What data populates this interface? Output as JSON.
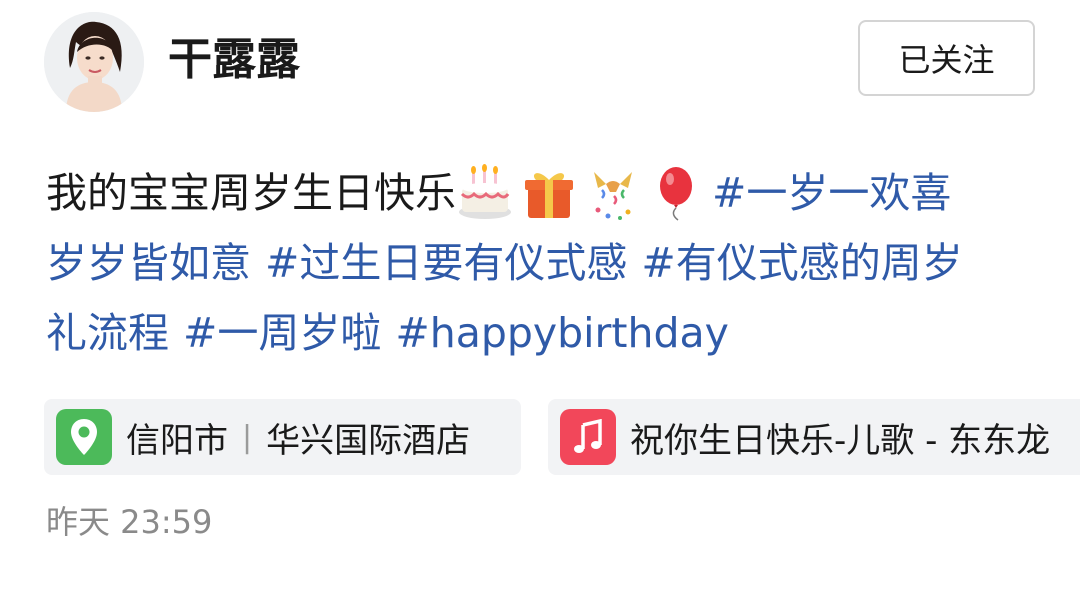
{
  "author": {
    "name": "干露露",
    "follow_label": "已关注"
  },
  "post": {
    "line1_text": "我的宝宝周岁生日快乐",
    "emojis": [
      "birthday-cake-icon",
      "gift-icon",
      "party-popper-icon",
      "balloon-icon"
    ],
    "hashtags": {
      "tag1_part1": "#一岁一欢喜",
      "tag1_part2": "岁岁皆如意",
      "tag2": "#过生日要有仪式感",
      "tag3_part1": "#有仪式感的周岁",
      "tag3_part2": "礼流程",
      "tag4": "#一周岁啦",
      "tag5": "#happybirthday"
    }
  },
  "location": {
    "city": "信阳市",
    "place": "华兴国际酒店",
    "icon": "location-pin-icon",
    "icon_color": "#4cba5a"
  },
  "music": {
    "title": "祝你生日快乐-儿歌 - 东东龙",
    "icon": "music-note-icon",
    "icon_color": "#f2475a"
  },
  "timestamp": "昨天 23:59",
  "colors": {
    "hashtag": "#2f5aa8",
    "chip_bg": "#f2f3f5"
  }
}
